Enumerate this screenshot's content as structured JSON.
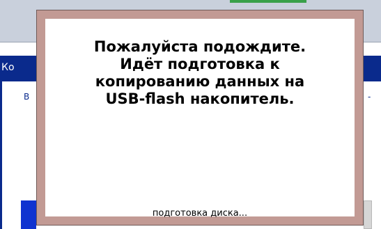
{
  "background_app": {
    "title_fragment": "Ко",
    "left_text_fragment": "В",
    "right_text_fragment": "-"
  },
  "dialog": {
    "message_lines": [
      "Пожалуйста подождите.",
      "Идёт подготовка к",
      "копированию данных на",
      "USB-flash накопитель."
    ],
    "status": "подготовка диска..."
  },
  "colors": {
    "dialog_frame": "#c29a94",
    "titlebar": "#0a2a8c",
    "accent_green": "#39a049",
    "button_blue": "#1033d0"
  }
}
